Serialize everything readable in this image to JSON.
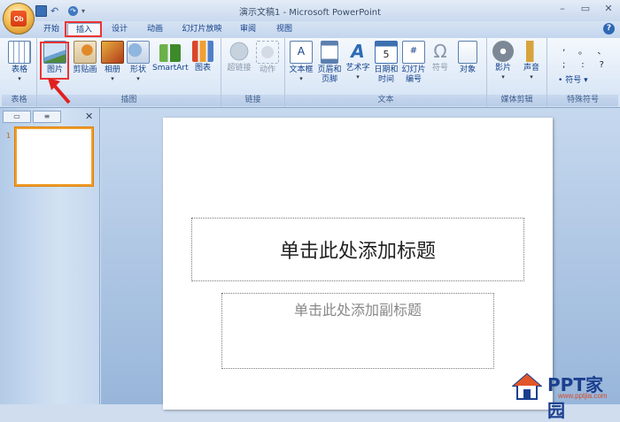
{
  "window": {
    "title": "演示文稿1 - Microsoft PowerPoint"
  },
  "office_button": {
    "glyph": "Ob"
  },
  "quick_access": {
    "save": "save-icon",
    "undo": "↶",
    "redo": "↷",
    "menu": "▾"
  },
  "window_controls": {
    "minimize": "–",
    "maximize": "▭",
    "close": "✕"
  },
  "tabs": [
    {
      "label": "开始"
    },
    {
      "label": "插入",
      "active": true
    },
    {
      "label": "设计"
    },
    {
      "label": "动画"
    },
    {
      "label": "幻灯片放映"
    },
    {
      "label": "审阅"
    },
    {
      "label": "视图"
    }
  ],
  "help": "?",
  "ribbon": {
    "groups": [
      {
        "label": "表格",
        "buttons": [
          {
            "label": "表格",
            "drop": "▾"
          }
        ]
      },
      {
        "label": "插图",
        "buttons": [
          {
            "label": "图片"
          },
          {
            "label": "剪贴画"
          },
          {
            "label": "相册",
            "drop": "▾"
          },
          {
            "label": "形状",
            "drop": "▾"
          },
          {
            "label": "SmartArt"
          },
          {
            "label": "图表"
          }
        ]
      },
      {
        "label": "链接",
        "buttons": [
          {
            "label": "超链接"
          },
          {
            "label": "动作"
          }
        ]
      },
      {
        "label": "文本",
        "buttons": [
          {
            "label": "文本框",
            "drop": "▾"
          },
          {
            "label": "页眉和",
            "label2": "页脚"
          },
          {
            "label": "艺术字",
            "drop": "▾"
          },
          {
            "label": "日期和",
            "label2": "时间"
          },
          {
            "label": "幻灯片",
            "label2": "编号"
          },
          {
            "label": "符号"
          },
          {
            "label": "对象"
          }
        ]
      },
      {
        "label": "媒体剪辑",
        "buttons": [
          {
            "label": "影片",
            "drop": "▾"
          },
          {
            "label": "声音",
            "drop": "▾"
          }
        ]
      },
      {
        "label": "特殊符号",
        "buttons": [
          {
            "label": "符号",
            "drop": "▾"
          }
        ],
        "symbols": [
          ",",
          "。",
          "、",
          ";",
          ":",
          "?"
        ]
      }
    ]
  },
  "slides_panel": {
    "tab_slides": "▭",
    "tab_outline": "≡",
    "close": "✕",
    "slide_number": "1"
  },
  "slide": {
    "title_placeholder": "单击此处添加标题",
    "subtitle_placeholder": "单击此处添加副标题"
  },
  "watermark": {
    "text": "PPT家园",
    "url": "www.pptjia.com"
  },
  "colors": {
    "accent_red": "#e33333",
    "ribbon_text": "#15428b",
    "thumb_border": "#f0a030"
  }
}
